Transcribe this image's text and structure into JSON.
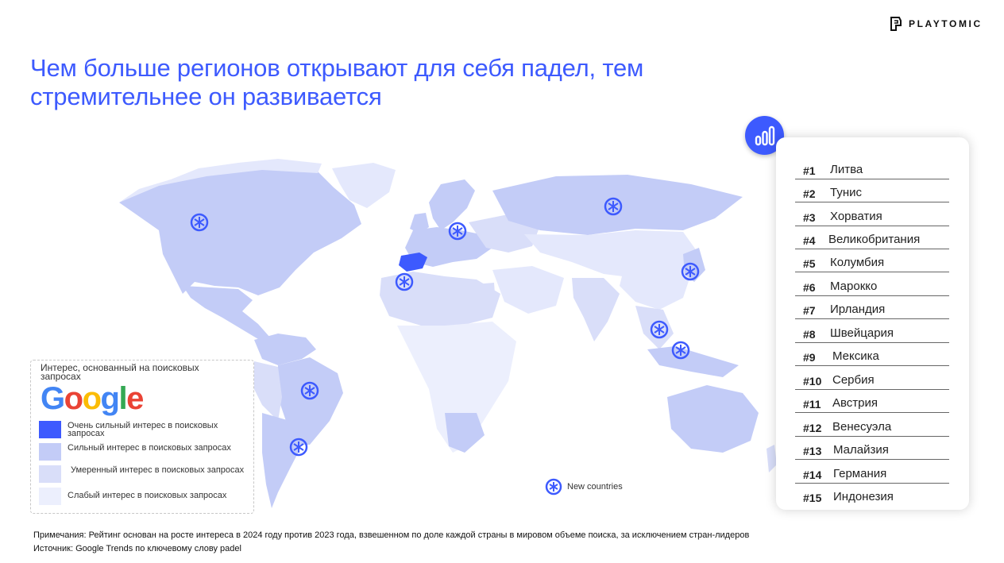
{
  "brand": {
    "name": "PLAYTOMIC",
    "icon": "playtomic-logo-icon"
  },
  "title": "Чем больше регионов открывают для себя падел, тем стремительнее он развивается",
  "legend": {
    "heading": "Интерес, основанный на поисковых запросах",
    "logo_text": "Google",
    "items": [
      {
        "label": "Очень сильный интерес в поисковых запросах",
        "color": "#3d5afe"
      },
      {
        "label": "Сильный интерес в поисковых запросах",
        "color": "#c3ccf7"
      },
      {
        "label": "Умеренный интерес в поисковых запросах",
        "color": "#d9def9"
      },
      {
        "label": "Слабый интерес в поисковых запросах",
        "color": "#eceffd"
      }
    ]
  },
  "new_countries_label": "New countries",
  "ranking": {
    "icon": "bar-chart-icon",
    "items": [
      {
        "rank": "#1",
        "name": "Литва"
      },
      {
        "rank": "#2",
        "name": "Тунис"
      },
      {
        "rank": "#3",
        "name": "Хорватия"
      },
      {
        "rank": "#4",
        "name": "Великобритания"
      },
      {
        "rank": "#5",
        "name": "Колумбия"
      },
      {
        "rank": "#6",
        "name": "Марокко"
      },
      {
        "rank": "#7",
        "name": "Ирландия"
      },
      {
        "rank": "#8",
        "name": "Швейцария"
      },
      {
        "rank": "#9",
        "name": "Мексика"
      },
      {
        "rank": "#10",
        "name": "Сербия"
      },
      {
        "rank": "#11",
        "name": "Австрия"
      },
      {
        "rank": "#12",
        "name": "Венесуэла"
      },
      {
        "rank": "#13",
        "name": "Малайзия"
      },
      {
        "rank": "#14",
        "name": "Германия"
      },
      {
        "rank": "#15",
        "name": "Индонезия"
      }
    ]
  },
  "notes": {
    "line1": "Примечания: Рейтинг основан на росте интереса в 2024 году против 2023 года, взвешенном по доле каждой страны в мировом объеме поиска, за исключением стран-лидеров",
    "line2": "Источник: Google Trends по ключевому слову padel"
  },
  "map_colors": {
    "strong": "#c3ccf7",
    "moderate": "#d9def9",
    "weak": "#eceffd",
    "very_strong": "#3d5afe"
  }
}
